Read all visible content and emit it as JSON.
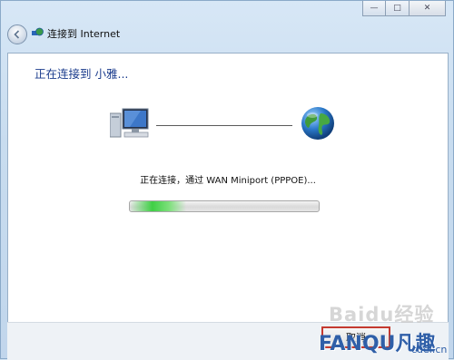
{
  "window": {
    "title": "连接到 Internet",
    "controls": {
      "minimize": "—",
      "maximize": "□",
      "close": "✕"
    }
  },
  "main": {
    "heading": "正在连接到 小雅...",
    "status": "正在连接，通过 WAN Miniport (PPPOE)...",
    "progress_percent": 30,
    "icons": {
      "source": "computer-icon",
      "destination": "globe-icon"
    }
  },
  "footer": {
    "cancel_label": "取消"
  },
  "watermark": {
    "logo": "Baidu经验",
    "brand": "FANQU凡趣",
    "domain": "cuel.cn"
  },
  "colors": {
    "heading": "#1a3b8c",
    "progress": "#3fcf45"
  }
}
